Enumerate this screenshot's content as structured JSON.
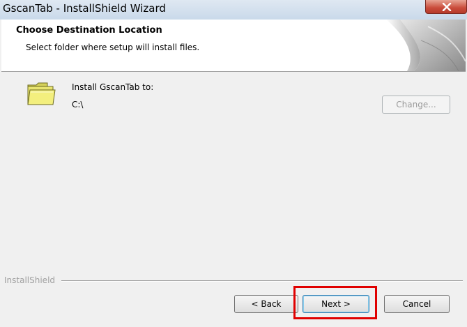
{
  "window": {
    "title": "GscanTab - InstallShield Wizard"
  },
  "header": {
    "title": "Choose Destination Location",
    "subtitle": "Select folder where setup will install files."
  },
  "main": {
    "install_label": "Install GscanTab to:",
    "install_path": "C:\\",
    "change_label": "Change..."
  },
  "footer": {
    "brand": "InstallShield",
    "back_label": "< Back",
    "next_label": "Next >",
    "cancel_label": "Cancel"
  },
  "icons": {
    "folder": "folder-icon",
    "close": "close-icon"
  },
  "colors": {
    "highlight": "#e00000",
    "close_button": "#c94b3a"
  }
}
